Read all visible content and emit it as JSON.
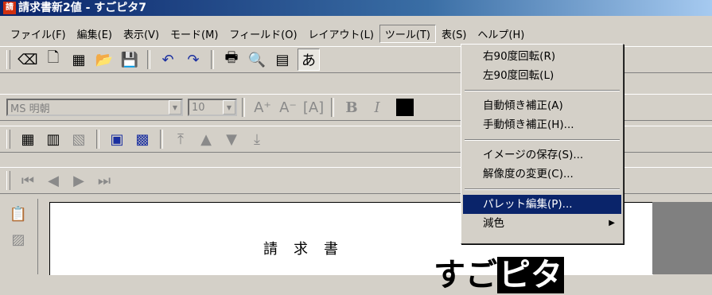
{
  "window": {
    "title": "請求書新2値 - すごピタ7",
    "icon": "app-icon"
  },
  "menubar": {
    "items": [
      {
        "label": "ファイル(F)",
        "name": "menu-file"
      },
      {
        "label": "編集(E)",
        "name": "menu-edit"
      },
      {
        "label": "表示(V)",
        "name": "menu-view"
      },
      {
        "label": "モード(M)",
        "name": "menu-mode"
      },
      {
        "label": "フィールド(O)",
        "name": "menu-field"
      },
      {
        "label": "レイアウト(L)",
        "name": "menu-layout"
      },
      {
        "label": "ツール(T)",
        "name": "menu-tools"
      },
      {
        "label": "表(S)",
        "name": "menu-table"
      },
      {
        "label": "ヘルプ(H)",
        "name": "menu-help"
      }
    ],
    "active": "ツール(T)"
  },
  "font_toolbar": {
    "font_name": "MS 明朝",
    "font_size": "10",
    "bold_label": "B",
    "italic_label": "I"
  },
  "tools_menu": {
    "items": [
      {
        "label": "右90度回転(R)"
      },
      {
        "label": "左90度回転(L)"
      },
      {
        "label": "自動傾き補正(A)"
      },
      {
        "label": "手動傾き補正(H)..."
      },
      {
        "label": "イメージの保存(S)..."
      },
      {
        "label": "解像度の変更(C)..."
      },
      {
        "label": "パレット編集(P)...",
        "selected": true
      },
      {
        "label": "減色",
        "has_submenu": true
      }
    ]
  },
  "document": {
    "heading": "請求書",
    "logo_prefix": "すご",
    "logo_highlight": "ピタ"
  },
  "colors": {
    "title_start": "#0a246a",
    "title_end": "#a6caf0",
    "highlight": "#0a246a",
    "face": "#d4d0c8"
  }
}
